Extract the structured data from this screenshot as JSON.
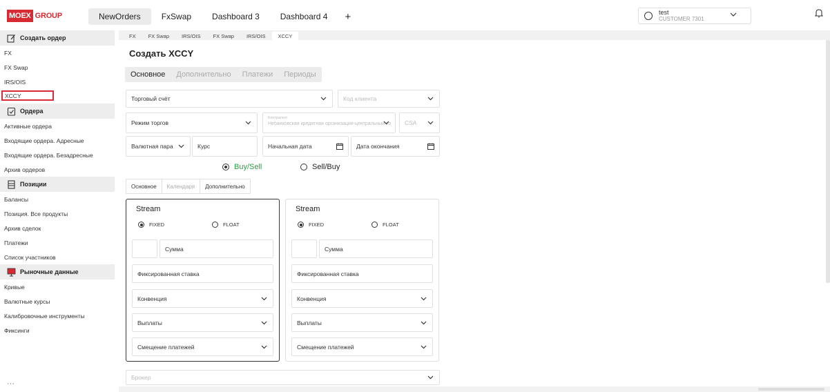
{
  "brand": {
    "part1": "MOEX",
    "part2": "GROUP"
  },
  "top_tabs": [
    "NewOrders",
    "FxSwap",
    "Dashboard 3",
    "Dashboard 4"
  ],
  "add_tab": "+",
  "user": {
    "name": "test",
    "org": "CUSTOMER 7301"
  },
  "sidebar": {
    "sections": [
      {
        "title": "Создать ордер",
        "icon": "edit-icon",
        "items": [
          "FX",
          "FX Swap",
          "IRS/OIS",
          "XCCY"
        ]
      },
      {
        "title": "Ордера",
        "icon": "checklist-icon",
        "items": [
          "Активные ордера",
          "Входящие ордера. Адресные",
          "Входящие ордера. Безадресные",
          "Архив ордеров"
        ]
      },
      {
        "title": "Позиции",
        "icon": "list-icon",
        "items": [
          "Балансы",
          "Позиция. Все продукты",
          "Архив сделок",
          "Платежи",
          "Список участников"
        ]
      },
      {
        "title": "Рыночные данные",
        "icon": "chart-board-icon",
        "items": [
          "Кривые",
          "Валютные курсы",
          "Калибровочные инструменты",
          "Фиксинги"
        ]
      }
    ],
    "more": "···"
  },
  "sub_tabs": [
    "FX",
    "FX Swap",
    "IRS/OIS",
    "FX Swap",
    "IRS/OIS",
    "XCCY"
  ],
  "page_title": "Создать XCCY",
  "page_tabs": [
    "Основное",
    "Дополнительно",
    "Платежи",
    "Периоды"
  ],
  "form": {
    "account": "Торговый счёт",
    "client_code": "Код клиента",
    "trade_mode": "Режим торгов",
    "counterparty_label": "Контрагент",
    "counterparty_value": "Небанковская кредитная организация-центральный контрагент",
    "csa": "CSA",
    "currency_pair": "Валютная пара",
    "rate": "Курс",
    "start_date": "Начальная дата",
    "end_date": "Дата окончания",
    "direction": {
      "option1": "Buy/Sell",
      "option2": "Sell/Buy"
    },
    "inner_tabs": [
      "Основное",
      "Календаря",
      "Дополнительно"
    ],
    "broker": "Брокер"
  },
  "streams": [
    {
      "title": "Stream",
      "fixed": "FIXED",
      "float": "FLOAT",
      "amount": "Сумма",
      "fixed_rate": "Фиксированная ставка",
      "convention": "Конвенция",
      "payments": "Выплаты",
      "shift": "Смещение платежей"
    },
    {
      "title": "Stream",
      "fixed": "FIXED",
      "float": "FLOAT",
      "amount": "Сумма",
      "fixed_rate": "Фиксированная ставка",
      "convention": "Конвенция",
      "payments": "Выплаты",
      "shift": "Смещение платежей"
    }
  ],
  "colors": {
    "brand": "#d82a32",
    "accent_green": "#2a9d42",
    "highlight": "#d82a32"
  }
}
